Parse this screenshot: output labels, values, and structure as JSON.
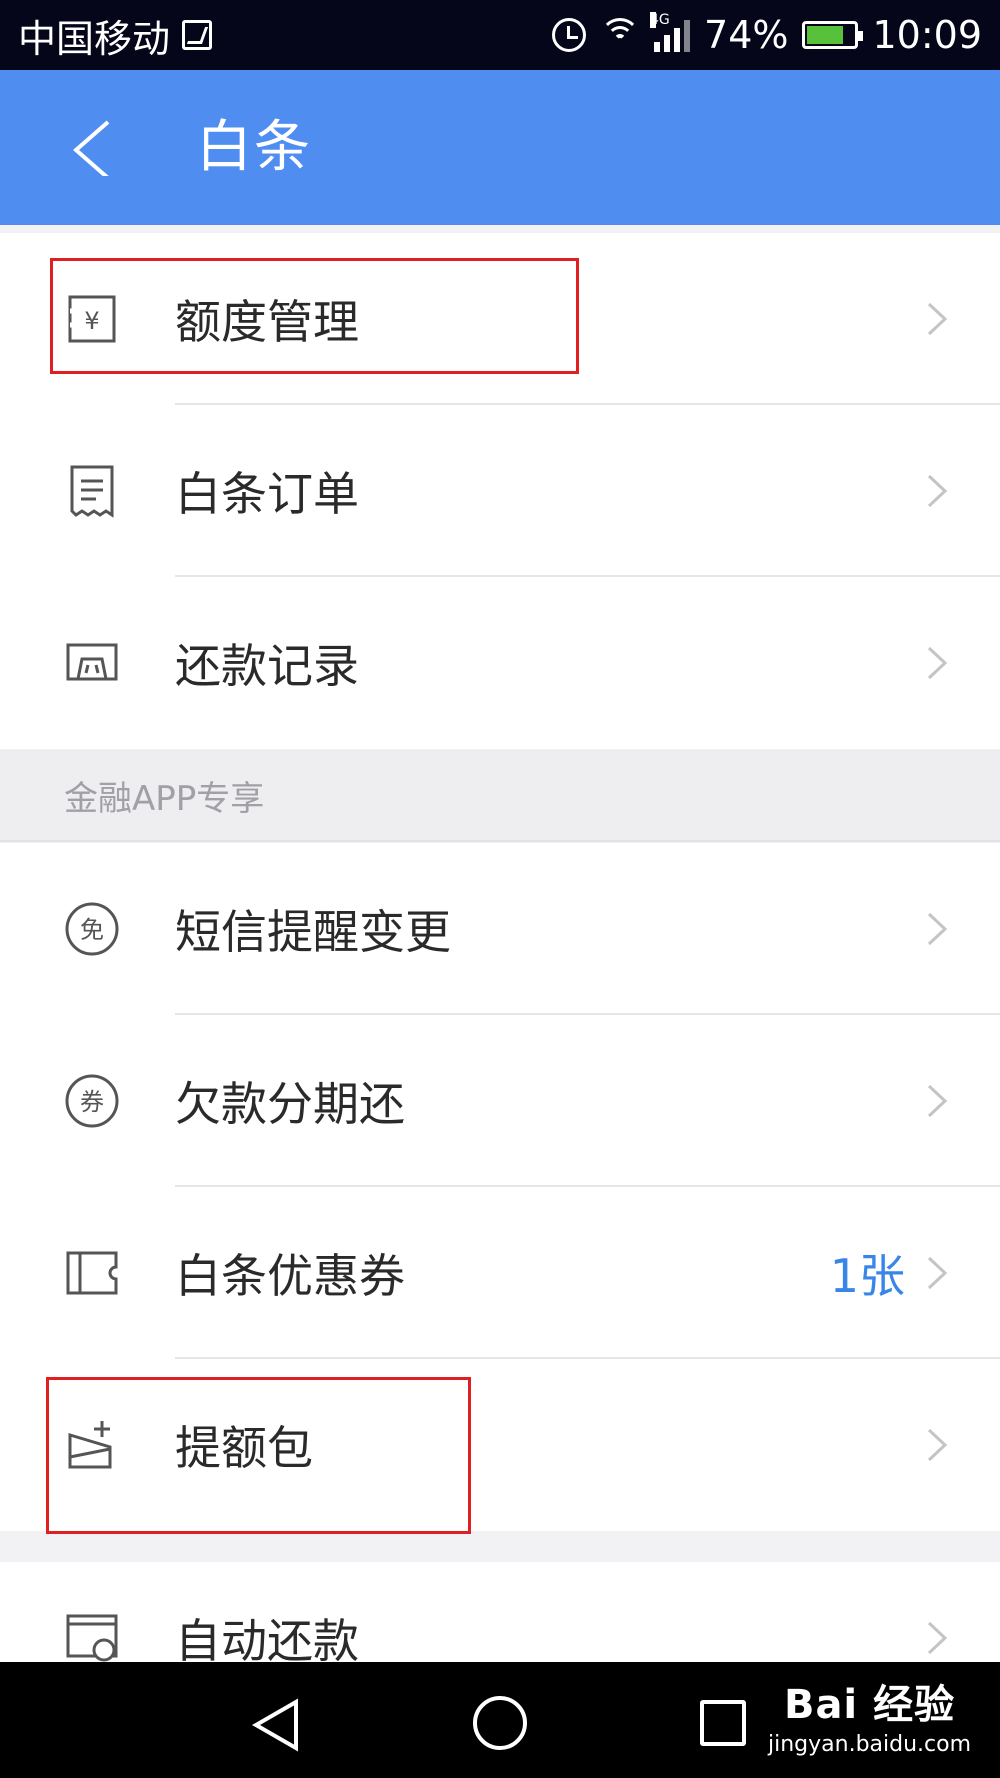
{
  "status_bar": {
    "carrier": "中国移动",
    "network": "4G",
    "battery": "74%",
    "time": "10:09"
  },
  "header": {
    "title": "白条"
  },
  "group1": [
    {
      "label": "额度管理",
      "icon": "yen-receipt-icon"
    },
    {
      "label": "白条订单",
      "icon": "order-receipt-icon"
    },
    {
      "label": "还款记录",
      "icon": "repayment-record-icon"
    }
  ],
  "section": {
    "title": "金融APP专享"
  },
  "group2": [
    {
      "label": "短信提醒变更",
      "icon": "free-badge-icon"
    },
    {
      "label": "欠款分期还",
      "icon": "coupon-badge-icon"
    },
    {
      "label": "白条优惠券",
      "icon": "ticket-icon",
      "value": "1张"
    },
    {
      "label": "提额包",
      "icon": "limit-boost-icon"
    }
  ],
  "group3": [
    {
      "label": "自动还款",
      "icon": "auto-repay-icon"
    }
  ],
  "watermark": {
    "brand": "Bai 经验",
    "url": "jingyan.baidu.com"
  },
  "colors": {
    "header_bg": "#508df0",
    "accent": "#3a86e8",
    "highlight": "#e02020"
  }
}
